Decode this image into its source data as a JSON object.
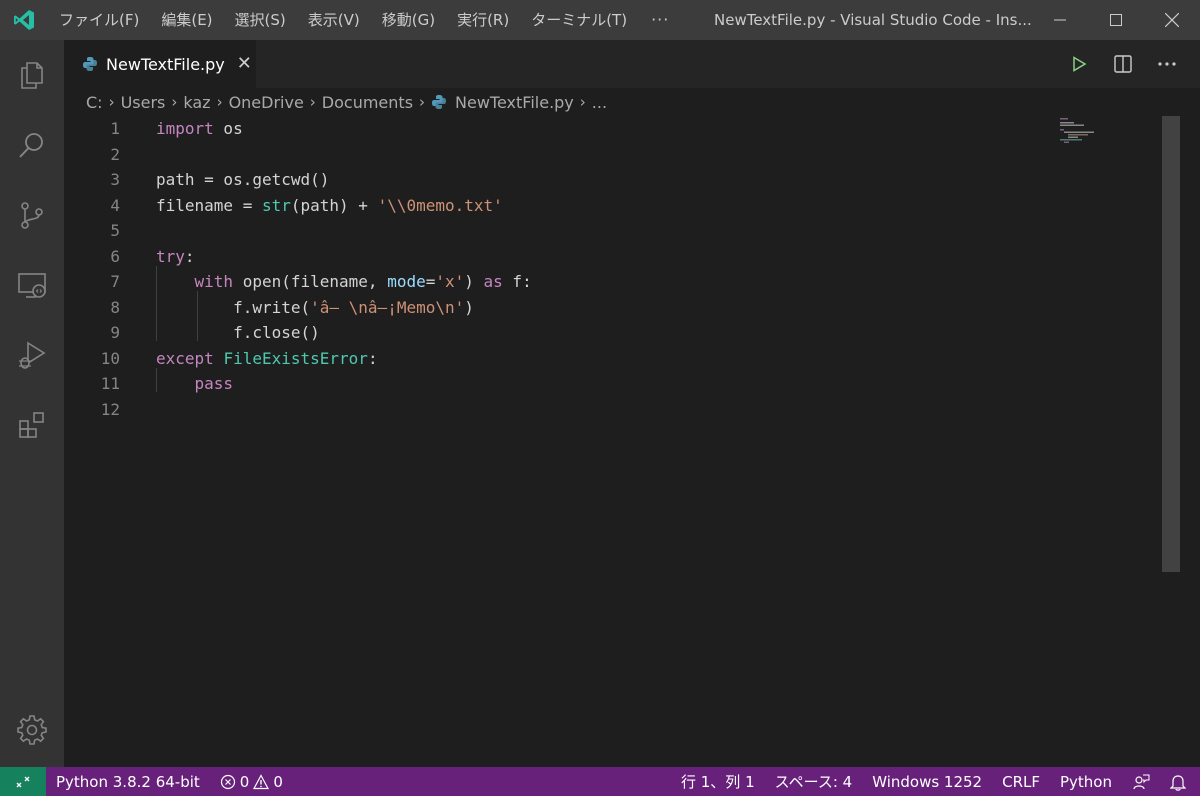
{
  "titlebar": {
    "menus": [
      "ファイル(F)",
      "編集(E)",
      "選択(S)",
      "表示(V)",
      "移動(G)",
      "実行(R)",
      "ターミナル(T)",
      "···"
    ],
    "window_title": "NewTextFile.py - Visual Studio Code - Ins..."
  },
  "tab": {
    "label": "NewTextFile.py"
  },
  "breadcrumb": {
    "parts": [
      "C:",
      "Users",
      "kaz",
      "OneDrive",
      "Documents"
    ],
    "file": "NewTextFile.py",
    "more": "..."
  },
  "editor": {
    "line_numbers": [
      "1",
      "2",
      "3",
      "4",
      "5",
      "6",
      "7",
      "8",
      "9",
      "10",
      "11",
      "12"
    ],
    "lines": [
      [
        {
          "t": "import",
          "c": "kw"
        },
        {
          "t": " os",
          "c": "plain"
        }
      ],
      [],
      [
        {
          "t": "path",
          "c": "plain"
        },
        {
          "t": " = os.",
          "c": "plain"
        },
        {
          "t": "getcwd",
          "c": "plain"
        },
        {
          "t": "()",
          "c": "plain"
        }
      ],
      [
        {
          "t": "filename = ",
          "c": "plain"
        },
        {
          "t": "str",
          "c": "bi"
        },
        {
          "t": "(path) + ",
          "c": "plain"
        },
        {
          "t": "'\\\\0memo.txt'",
          "c": "str"
        }
      ],
      [],
      [
        {
          "t": "try",
          "c": "kw"
        },
        {
          "t": ":",
          "c": "plain"
        }
      ],
      [
        {
          "t": "    ",
          "c": "plain"
        },
        {
          "t": "with",
          "c": "kw"
        },
        {
          "t": " open(filename, ",
          "c": "plain"
        },
        {
          "t": "mode",
          "c": "var"
        },
        {
          "t": "=",
          "c": "plain"
        },
        {
          "t": "'x'",
          "c": "str"
        },
        {
          "t": ") ",
          "c": "plain"
        },
        {
          "t": "as",
          "c": "kw"
        },
        {
          "t": " f:",
          "c": "plain"
        }
      ],
      [
        {
          "t": "        f.write(",
          "c": "plain"
        },
        {
          "t": "'â– \\nâ–¡Memo\\n'",
          "c": "str"
        },
        {
          "t": ")",
          "c": "plain"
        }
      ],
      [
        {
          "t": "        f.close()",
          "c": "plain"
        }
      ],
      [
        {
          "t": "except",
          "c": "kw"
        },
        {
          "t": " ",
          "c": "plain"
        },
        {
          "t": "FileExistsError",
          "c": "bi"
        },
        {
          "t": ":",
          "c": "plain"
        }
      ],
      [
        {
          "t": "    ",
          "c": "plain"
        },
        {
          "t": "pass",
          "c": "kw"
        }
      ],
      []
    ]
  },
  "statusbar": {
    "interpreter": "Python 3.8.2 64-bit",
    "errors": "0",
    "warnings": "0",
    "position": "行 1、列 1",
    "spaces": "スペース: 4",
    "encoding": "Windows 1252",
    "eol": "CRLF",
    "language": "Python"
  },
  "icons": {
    "app": "vscode-logo",
    "activity": [
      "explorer-icon",
      "search-icon",
      "source-control-icon",
      "remote-explorer-icon",
      "run-debug-icon",
      "extensions-icon",
      "settings-gear-icon"
    ]
  },
  "colors": {
    "statusbar": "#68217a",
    "remote": "#16825d",
    "keyword": "#c586c0",
    "builtin": "#4ec9b0",
    "string": "#ce9178"
  }
}
